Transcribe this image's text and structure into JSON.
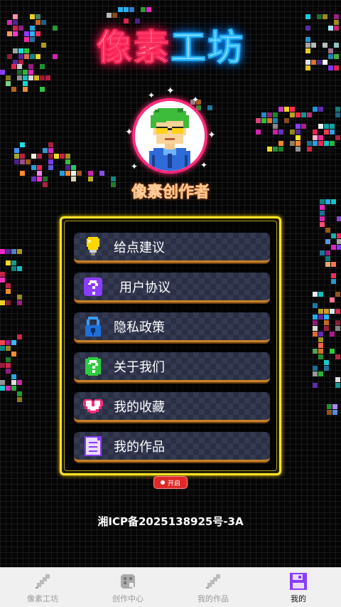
{
  "header": {
    "title_part1": "像素",
    "title_part2": "工坊"
  },
  "profile": {
    "username": "像素创作者",
    "avatar_icon": "pixel-avatar-icon"
  },
  "menu": {
    "items": [
      {
        "label": "给点建议",
        "icon": "lightbulb-icon"
      },
      {
        "label": "用户协议",
        "icon": "question-icon"
      },
      {
        "label": "隐私政策",
        "icon": "lock-icon"
      },
      {
        "label": "关于我们",
        "icon": "help-icon"
      },
      {
        "label": "我的收藏",
        "icon": "heart-icon"
      },
      {
        "label": "我的作品",
        "icon": "document-icon"
      }
    ]
  },
  "toggle": {
    "label": "开启"
  },
  "footer": {
    "icp": "湘ICP备2025138925号-3A"
  },
  "bottom_nav": {
    "items": [
      {
        "label": "像素工坊",
        "icon": "pencil-icon",
        "active": false
      },
      {
        "label": "创作中心",
        "icon": "palette-icon",
        "active": false
      },
      {
        "label": "我的作品",
        "icon": "edit-icon",
        "active": false
      },
      {
        "label": "我的",
        "icon": "save-icon",
        "active": true
      }
    ]
  },
  "colors": {
    "title_pink": "#ff2b5b",
    "title_blue": "#2cb8ff",
    "menu_border": "#ffe22a",
    "username": "#ff8a2a",
    "active_nav": "#8a3cff"
  }
}
